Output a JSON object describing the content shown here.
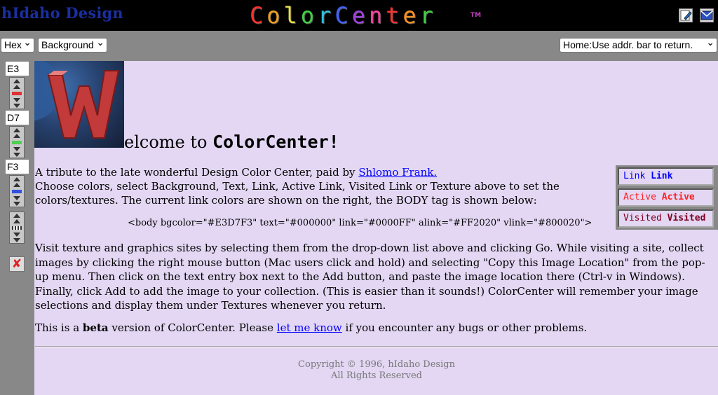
{
  "header": {
    "brand": "hIdaho Design",
    "title_letters": [
      "C",
      "o",
      "l",
      "o",
      "r",
      "C",
      "e",
      "n",
      "t",
      "e",
      "r"
    ],
    "title_colors": [
      "#ff3030",
      "#f0a020",
      "#e8e040",
      "#40d040",
      "#30c0e0",
      "#4060ff",
      "#a040e0",
      "#ff40a0",
      "#ff3030",
      "#ff9020",
      "#40d040"
    ],
    "tm": "TM"
  },
  "toolbar": {
    "format_select": "Hex",
    "target_select": "Background",
    "home_select": "Home:Use addr. bar to return."
  },
  "colors": {
    "red_hex": "E3",
    "green_hex": "D7",
    "blue_hex": "F3",
    "background": "#E3D7F3"
  },
  "main": {
    "welcome_prefix": "elcome to",
    "welcome_name": "ColorCenter!",
    "intro_line": "A tribute to the late wonderful Design Color Center, paid by",
    "intro_link": "Shlomo Frank.",
    "intro_rest": "Choose colors, select Background, Text, Link, Active Link, Visited Link or Texture above to set the colors/textures. The current link colors are shown on the right, the BODY tag is shown below:",
    "body_tag": "<body bgcolor=\"#E3D7F3\" text=\"#000000\" link=\"#0000FF\" alink=\"#FF2020\" vlink=\"#800020\">",
    "texture_para": "Visit texture and graphics sites by selecting them from the drop-down list above and clicking Go. While visiting a site, collect images by clicking the right mouse button (Mac users click and hold) and selecting \"Copy this Image Location\" from the pop-up menu. Then click on the text entry box next to the Add button, and paste the image location there (Ctrl-v in Windows). Finally, click Add to add the image to your collection. (This is easier than it sounds!) ColorCenter will remember your image selections and display them under Textures whenever you return.",
    "beta_pre": "This is a",
    "beta_word": "beta",
    "beta_mid": "version of ColorCenter. Please",
    "beta_link": "let me know",
    "beta_post": "if you encounter any bugs or other problems."
  },
  "link_preview": {
    "link_label": "Link",
    "link_bold": "Link",
    "link_color": "#0000FF",
    "active_label": "Active",
    "active_bold": "Active",
    "active_color": "#FF2020",
    "visited_label": "Visited",
    "visited_bold": "Visited",
    "visited_color": "#800020"
  },
  "footer": {
    "copyright": "Copyright © 1996, hIdaho Design",
    "rights": "All Rights Reserved"
  }
}
